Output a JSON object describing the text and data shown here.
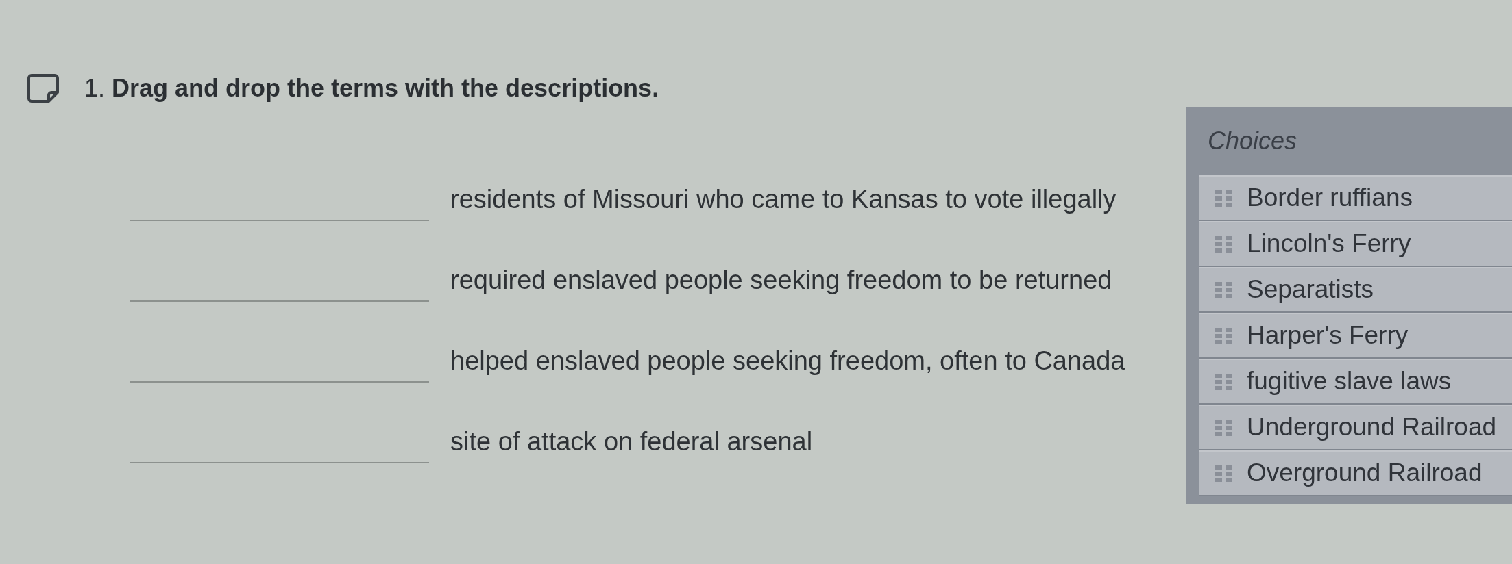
{
  "question": {
    "number": "1.",
    "prompt": "Drag and drop the terms with the descriptions."
  },
  "matches": [
    {
      "description": "residents of Missouri who came to Kansas to vote illegally"
    },
    {
      "description": "required enslaved people seeking freedom to be returned"
    },
    {
      "description": "helped enslaved people seeking freedom, often to Canada"
    },
    {
      "description": "site of attack on federal arsenal"
    }
  ],
  "choices": {
    "title": "Choices",
    "items": [
      {
        "label": "Border ruffians"
      },
      {
        "label": "Lincoln's Ferry"
      },
      {
        "label": "Separatists"
      },
      {
        "label": "Harper's Ferry"
      },
      {
        "label": "fugitive slave laws"
      },
      {
        "label": "Underground Railroad"
      },
      {
        "label": "Overground Railroad"
      }
    ]
  }
}
